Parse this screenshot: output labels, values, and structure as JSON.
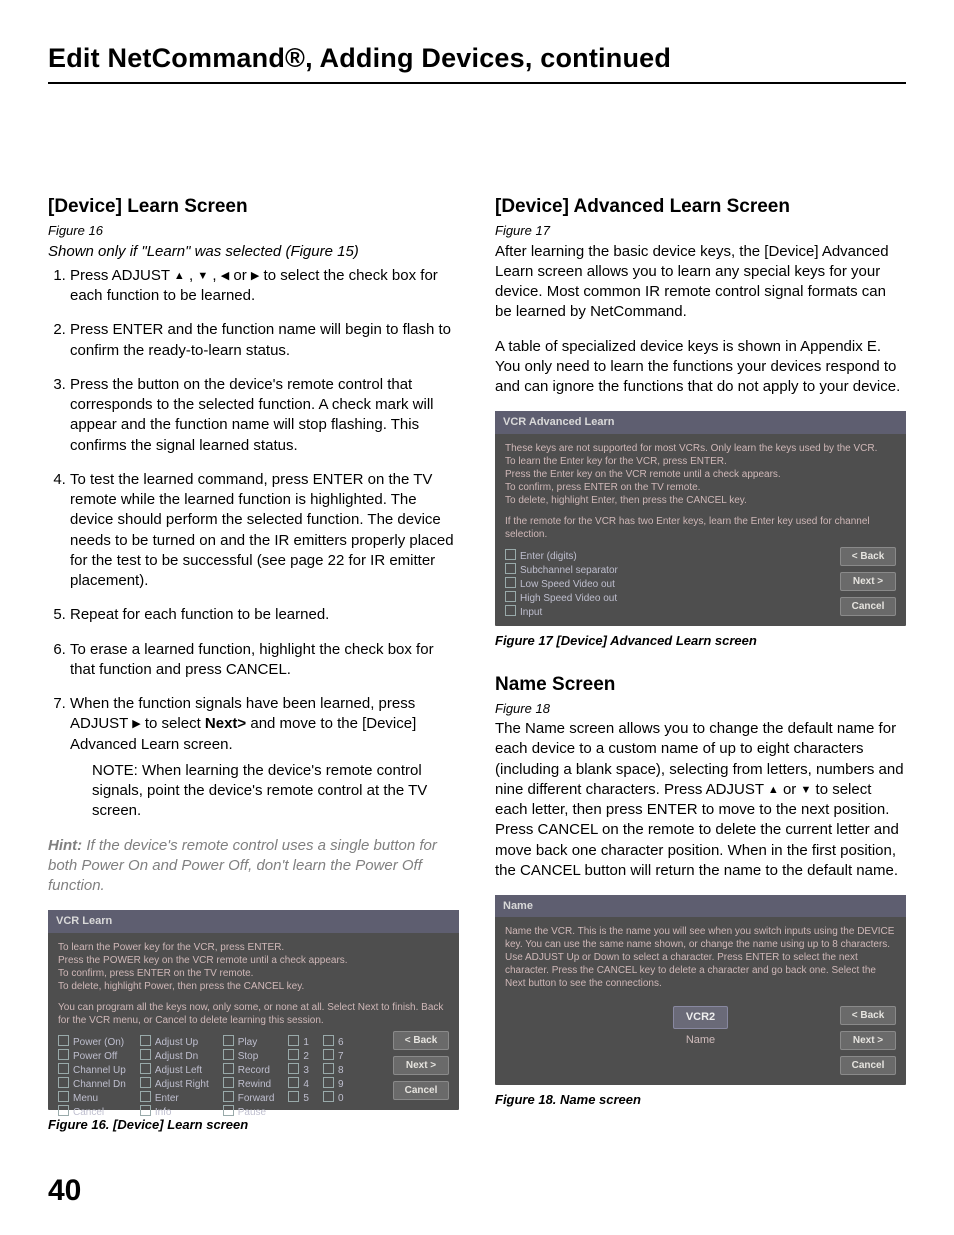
{
  "page_title": "Edit NetCommand®, Adding Devices, continued",
  "page_number": "40",
  "left": {
    "heading": "[Device] Learn Screen",
    "figref": "Figure 16",
    "shown": "Shown only if \"Learn\" was selected (Figure 15)",
    "step1_a": "Press ADJUST ",
    "step1_b": " , ",
    "step1_c": " , ",
    "step1_d": " or ",
    "step1_e": " to select the check box for each function to be learned.",
    "step2": "Press ENTER and the function name will begin to flash to confirm the ready-to-learn status.",
    "step3": "Press the button on the device's remote control that corresponds to the selected function.  A check mark will appear and the function name will stop flashing.  This confirms the signal learned status.",
    "step4": "To test the learned command, press ENTER on the TV remote while the learned function is highlighted.  The device should perform the selected function.  The device needs to be turned on and the IR emitters properly placed for the test to be successful (see page 22 for IR emitter placement).",
    "step5": "Repeat for each function to be learned.",
    "step6": "To erase a learned function, highlight the check box for that function and press CANCEL.",
    "step7_a": "When the function signals have been learned, press ADJUST ",
    "step7_b": "  to select ",
    "step7_next": "Next>",
    "step7_c": " and move to the [Device] Advanced Learn screen.",
    "note": "NOTE: When learning the device's remote control signals, point the device's remote control at the TV screen.",
    "hint_label": "Hint:",
    "hint_body": "  If the device's remote control uses a single button for both Power On and Power Off, don't learn the Power Off function.",
    "caption": "Figure 16.  [Device] Learn screen"
  },
  "right": {
    "adv_heading": "[Device] Advanced Learn Screen",
    "adv_figref": "Figure 17",
    "adv_p1": "After learning the basic device keys, the [Device] Advanced Learn screen allows you to learn any special keys for your device.  Most common IR remote control signal formats can be learned by NetCommand.",
    "adv_p2": "A table of specialized device keys is shown in Appendix E. You only need to learn the functions your devices respond to and can ignore the functions that do not apply to your device.",
    "adv_caption": "Figure 17  [Device] Advanced Learn screen",
    "name_heading": "Name Screen",
    "name_figref": "Figure 18",
    "name_p_a": "The Name screen allows you to change the default name for each device to a custom name of up to eight characters (including a blank space), selecting from letters, numbers and nine different characters.  Press ADJUST ",
    "name_p_b": " or ",
    "name_p_c": " to select each letter, then press ENTER to move to the next position.  Press CANCEL on the remote to delete the current letter and move back one character position.  When in the first position, the CANCEL button will return the name to the default name.",
    "name_caption": "Figure 18.  Name screen"
  },
  "shot16": {
    "title": "VCR Learn",
    "lines": [
      "To learn the Power key for the VCR, press ENTER.",
      "Press the POWER key on the VCR remote until a check appears.",
      "To confirm, press ENTER on the TV remote.",
      "To delete, highlight Power, then press the CANCEL key."
    ],
    "lines2": [
      "You can program all the keys now, only some, or none at all. Select Next to finish. Back for the VCR menu, or Cancel to delete learning this session."
    ],
    "cols": [
      [
        "Power (On)",
        "Power Off",
        "Channel Up",
        "Channel Dn",
        "Menu",
        "Cancel"
      ],
      [
        "Adjust Up",
        "Adjust Dn",
        "Adjust Left",
        "Adjust Right",
        "Enter",
        "Info"
      ],
      [
        "Play",
        "Stop",
        "Record",
        "Rewind",
        "Forward",
        "Pause"
      ],
      [
        "1",
        "2",
        "3",
        "4",
        "5"
      ],
      [
        "6",
        "7",
        "8",
        "9",
        "0"
      ]
    ],
    "btns": [
      "< Back",
      "Next >",
      "Cancel"
    ]
  },
  "shot17": {
    "title": "VCR Advanced Learn",
    "lines": [
      "These keys are not supported for most VCRs. Only learn the keys used by the VCR.",
      "To learn the Enter key for the VCR, press ENTER.",
      "Press the Enter key on the VCR remote until a check appears.",
      "To confirm, press ENTER on the TV remote.",
      "To delete, highlight Enter, then press the CANCEL key."
    ],
    "lines2": [
      "If the remote for the VCR has two Enter keys, learn the Enter key used for channel selection."
    ],
    "items": [
      "Enter (digits)",
      "Subchannel separator",
      "Low Speed Video out",
      "High Speed Video out",
      "Input"
    ],
    "btns": [
      "< Back",
      "Next >",
      "Cancel"
    ]
  },
  "shot18": {
    "title": "Name",
    "lines": [
      "Name the VCR.  This is the name you will see when you switch inputs using the DEVICE key.  You can use the same name shown, or change the name using up to 8 characters. Use ADJUST Up or Down to select a character.  Press ENTER to select the next character.  Press the CANCEL key to delete a character and go back one.  Select the Next button to see the connections."
    ],
    "chip": "VCR2",
    "chip_label": "Name",
    "btns": [
      "< Back",
      "Next >",
      "Cancel"
    ]
  }
}
